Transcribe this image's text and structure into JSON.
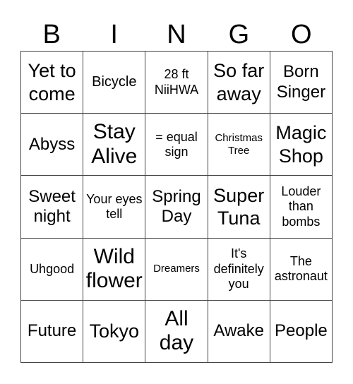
{
  "header": {
    "letters": [
      "B",
      "I",
      "N",
      "G",
      "O"
    ]
  },
  "cells": [
    [
      "Yet to come",
      "Bicycle",
      "28 ft NiiHWA",
      "So far away",
      "Born Singer"
    ],
    [
      "Abyss",
      "Stay Alive",
      "= equal sign",
      "Christmas Tree",
      "Magic Shop"
    ],
    [
      "Sweet night",
      "Your eyes tell",
      "Spring Day",
      "Super Tuna",
      "Louder than bombs"
    ],
    [
      "Uhgood",
      "Wild flower",
      "Dreamers",
      "It's definitely you",
      "The astronaut"
    ],
    [
      "Future",
      "Tokyo",
      "All day",
      "Awake",
      "People"
    ]
  ]
}
